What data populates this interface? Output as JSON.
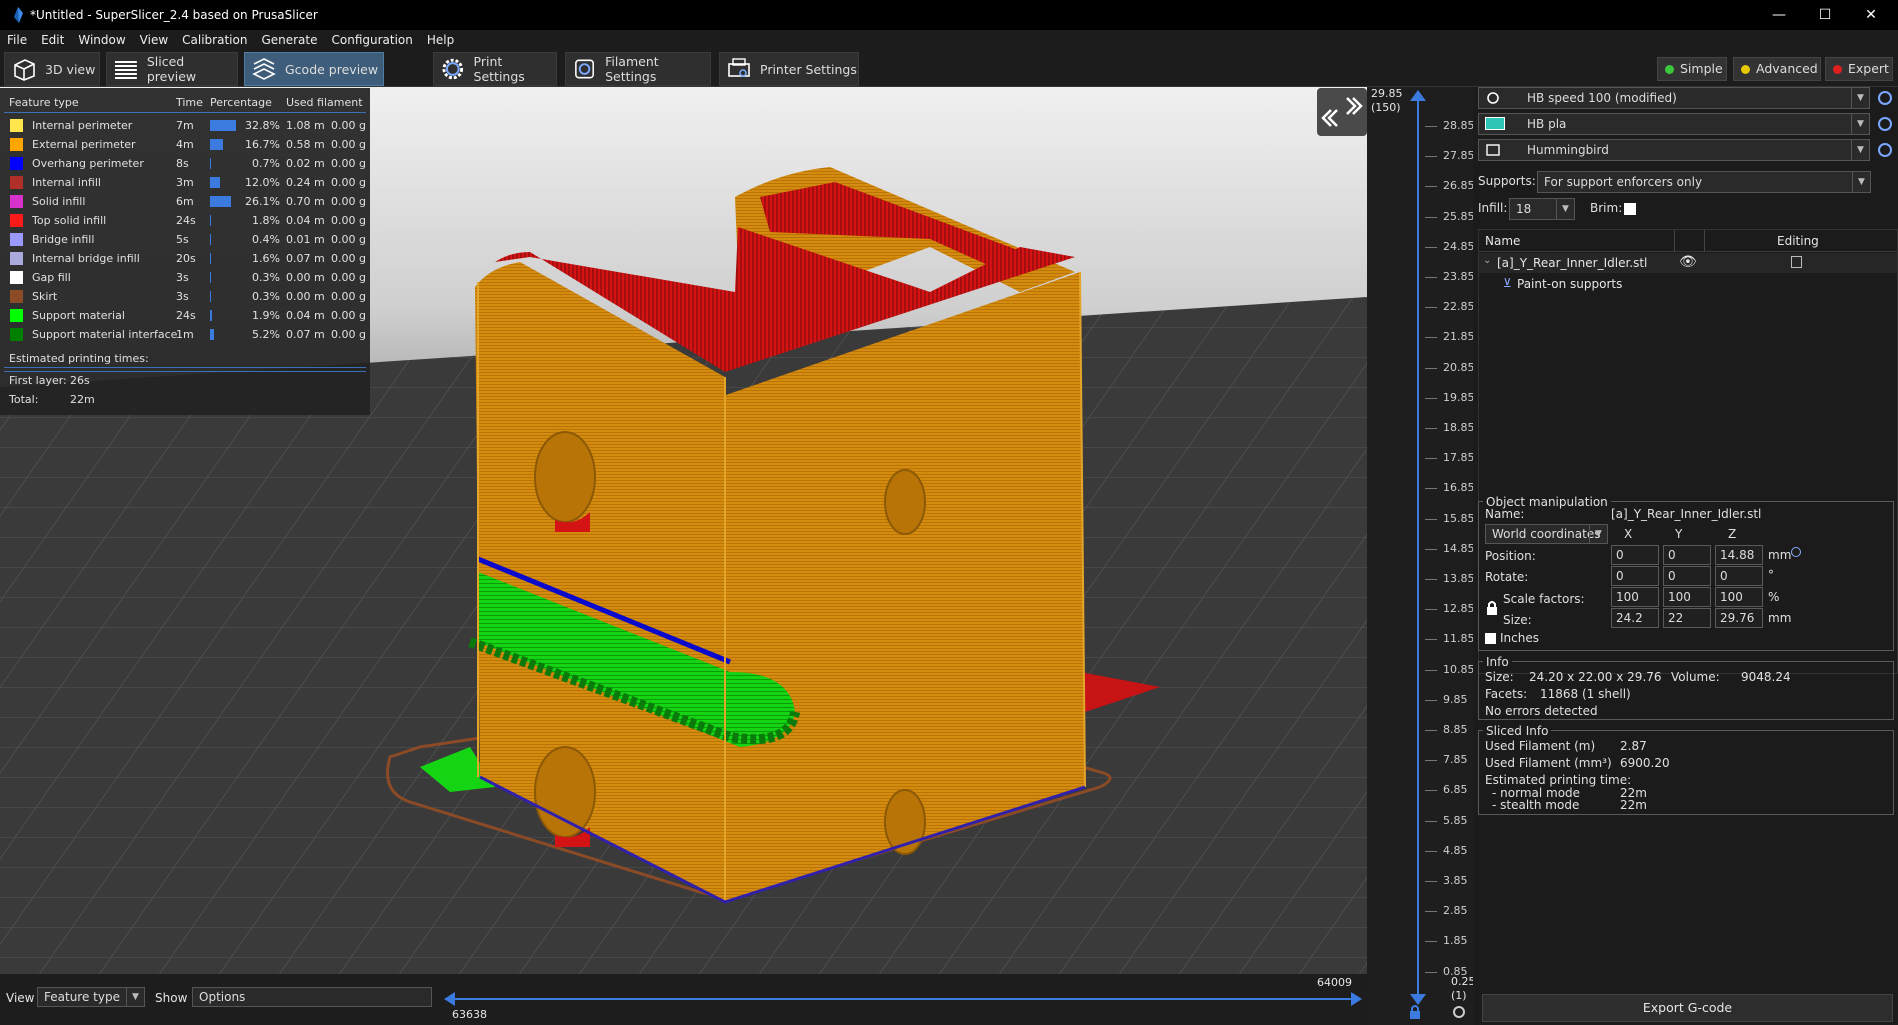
{
  "window": {
    "title": "*Untitled - SuperSlicer_2.4  based on PrusaSlicer",
    "min": "—",
    "max": "☐",
    "close": "✕"
  },
  "menu": [
    "File",
    "Edit",
    "Window",
    "View",
    "Calibration",
    "Generate",
    "Configuration",
    "Help"
  ],
  "tabs": {
    "view3d": "3D view",
    "sliced": "Sliced preview",
    "gcode": "Gcode preview",
    "print": "Print Settings",
    "filament": "Filament Settings",
    "printer": "Printer Settings"
  },
  "modes": {
    "simple": "Simple",
    "advanced": "Advanced",
    "expert": "Expert",
    "colors": {
      "simple": "#3cc83c",
      "advanced": "#e8c800",
      "expert": "#e02020"
    }
  },
  "legend": {
    "headers": {
      "feature": "Feature type",
      "time": "Time",
      "percentage": "Percentage",
      "filament": "Used filament"
    },
    "rows": [
      {
        "name": "Internal perimeter",
        "color": "#ffe64d",
        "time": "7m",
        "pct": "32.8%",
        "pct_value": 32.8,
        "len": "1.08 m",
        "g": "0.00 g"
      },
      {
        "name": "External perimeter",
        "color": "#ffa500",
        "time": "4m",
        "pct": "16.7%",
        "pct_value": 16.7,
        "len": "0.58 m",
        "g": "0.00 g"
      },
      {
        "name": "Overhang perimeter",
        "color": "#0000ff",
        "time": "8s",
        "pct": "0.7%",
        "pct_value": 0.7,
        "len": "0.02 m",
        "g": "0.00 g"
      },
      {
        "name": "Internal infill",
        "color": "#b03029",
        "time": "3m",
        "pct": "12.0%",
        "pct_value": 12.0,
        "len": "0.24 m",
        "g": "0.00 g"
      },
      {
        "name": "Solid infill",
        "color": "#d733cc",
        "time": "6m",
        "pct": "26.1%",
        "pct_value": 26.1,
        "len": "0.70 m",
        "g": "0.00 g"
      },
      {
        "name": "Top solid infill",
        "color": "#ff1a1a",
        "time": "24s",
        "pct": "1.8%",
        "pct_value": 1.8,
        "len": "0.04 m",
        "g": "0.00 g"
      },
      {
        "name": "Bridge infill",
        "color": "#9999ff",
        "time": "5s",
        "pct": "0.4%",
        "pct_value": 0.4,
        "len": "0.01 m",
        "g": "0.00 g"
      },
      {
        "name": "Internal bridge infill",
        "color": "#aaaadd",
        "time": "20s",
        "pct": "1.6%",
        "pct_value": 1.6,
        "len": "0.07 m",
        "g": "0.00 g"
      },
      {
        "name": "Gap fill",
        "color": "#ffffff",
        "time": "3s",
        "pct": "0.3%",
        "pct_value": 0.3,
        "len": "0.00 m",
        "g": "0.00 g"
      },
      {
        "name": "Skirt",
        "color": "#8a4b26",
        "time": "3s",
        "pct": "0.3%",
        "pct_value": 0.3,
        "len": "0.00 m",
        "g": "0.00 g"
      },
      {
        "name": "Support material",
        "color": "#00ff00",
        "time": "24s",
        "pct": "1.9%",
        "pct_value": 1.9,
        "len": "0.04 m",
        "g": "0.00 g"
      },
      {
        "name": "Support material interface",
        "color": "#008000",
        "time": "1m",
        "pct": "5.2%",
        "pct_value": 5.2,
        "len": "0.07 m",
        "g": "0.00 g"
      }
    ],
    "estimated_label": "Estimated printing times:",
    "first_layer_label": "First layer:",
    "first_layer_value": "26s",
    "total_label": "Total:",
    "total_value": "22m"
  },
  "vslider": {
    "top_value": "29.85",
    "top_layer": "(150)",
    "bottom_value": "0.25",
    "bottom_layer": "(1)",
    "ticks": [
      "28.85",
      "27.85",
      "26.85",
      "25.85",
      "24.85",
      "23.85",
      "22.85",
      "21.85",
      "20.85",
      "19.85",
      "18.85",
      "17.85",
      "16.85",
      "15.85",
      "14.85",
      "13.85",
      "12.85",
      "11.85",
      "10.85",
      "9.85",
      "8.85",
      "7.85",
      "6.85",
      "5.85",
      "4.85",
      "3.85",
      "2.85",
      "1.85",
      "0.85"
    ]
  },
  "bottom": {
    "view_label": "View",
    "view_value": "Feature type",
    "show_label": "Show",
    "show_value": "Options",
    "slider_right": "64009",
    "slider_left": "63638"
  },
  "presets": {
    "print": "HB speed 100 (modified)",
    "filament": "HB pla",
    "filament_color": "#2ec4b6",
    "printer": "Hummingbird"
  },
  "supports": {
    "label": "Supports:",
    "value": "For support enforcers only"
  },
  "infill": {
    "label": "Infill:",
    "value": "18"
  },
  "brim": {
    "label": "Brim:"
  },
  "objlist": {
    "col_name": "Name",
    "col_editing": "Editing",
    "object": "[a]_Y_Rear_Inner_Idler.stl",
    "child": "Paint-on supports"
  },
  "manip": {
    "title": "Object manipulation",
    "name_label": "Name:",
    "name_value": "[a]_Y_Rear_Inner_Idler.stl",
    "coords": "World coordinates",
    "x": "X",
    "y": "Y",
    "z": "Z",
    "position_label": "Position:",
    "pos": [
      "0",
      "0",
      "14.88"
    ],
    "pos_unit": "mm",
    "rotate_label": "Rotate:",
    "rot": [
      "0",
      "0",
      "0"
    ],
    "rot_unit": "°",
    "scale_label": "Scale factors:",
    "scale": [
      "100",
      "100",
      "100"
    ],
    "scale_unit": "%",
    "size_label": "Size:",
    "size": [
      "24.2",
      "22",
      "29.76"
    ],
    "size_unit": "mm",
    "inches_label": "Inches"
  },
  "info": {
    "title": "Info",
    "size_label": "Size:",
    "size_value": "24.20 x 22.00 x 29.76",
    "volume_label": "Volume:",
    "volume_value": "9048.24",
    "facets_label": "Facets:",
    "facets_value": "11868 (1 shell)",
    "errors": "No errors detected"
  },
  "sliced": {
    "title": "Sliced Info",
    "used_m_label": "Used Filament (m)",
    "used_m": "2.87",
    "used_mm3_label": "Used Filament (mm³)",
    "used_mm3": "6900.20",
    "est_label": "Estimated printing time:",
    "normal_label": "- normal mode",
    "normal": "22m",
    "stealth_label": "- stealth mode",
    "stealth": "22m"
  },
  "export_label": "Export G-code"
}
